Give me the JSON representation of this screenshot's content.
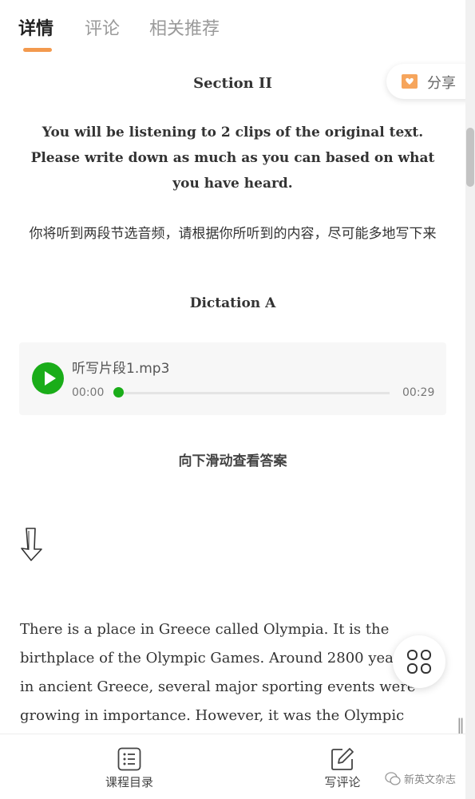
{
  "tabs": [
    {
      "label": "详情"
    },
    {
      "label": "评论"
    },
    {
      "label": "相关推荐"
    }
  ],
  "share": {
    "label": "分享",
    "icon": "heart-mail-icon"
  },
  "article": {
    "section_title": "Section II",
    "instruction_en": "You will be listening to 2 clips of the original text. Please write down as much as you can based on what you have heard.",
    "instruction_zh": "你将听到两段节选音频，请根据你所听到的内容，尽可能多地写下来",
    "dictation_title": "Dictation A",
    "scroll_hint": "向下滑动查看答案",
    "body": "There is a place in Greece called Olympia. It is the birthplace of the Olympic Games. Around 2800 years ago, in ancient Greece, several major sporting events were growing in importance. However, it was the Olympic Games"
  },
  "audio": {
    "file_name": "听写片段1.mp3",
    "current_time": "00:00",
    "total_time": "00:29",
    "progress": 0.0
  },
  "bottom_bar": {
    "catalog_label": "课程目录",
    "comment_label": "写评论"
  },
  "watermark": {
    "text": "新英文杂志"
  },
  "colors": {
    "accent": "#f39a4e",
    "player_green": "#1aad19"
  }
}
